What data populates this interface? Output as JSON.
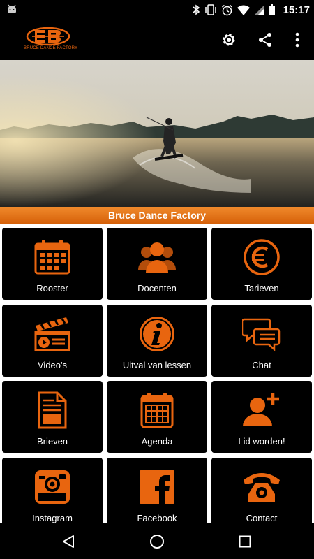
{
  "status_bar": {
    "time": "15:17",
    "icons": [
      "android-icon",
      "bluetooth-icon",
      "vibrate-icon",
      "alarm-icon",
      "wifi-icon",
      "signal-icon",
      "battery-icon"
    ]
  },
  "toolbar": {
    "logo_text": "BRUCE DANCE FACTORY",
    "actions": [
      "settings-icon",
      "share-icon",
      "overflow-menu-icon"
    ]
  },
  "banner": {
    "title": "Bruce Dance Factory"
  },
  "menu": [
    {
      "label": "Rooster",
      "icon": "calendar-grid-icon"
    },
    {
      "label": "Docenten",
      "icon": "people-icon"
    },
    {
      "label": "Tarieven",
      "icon": "euro-icon"
    },
    {
      "label": "Video's",
      "icon": "video-clapper-icon"
    },
    {
      "label": "Uitval van lessen",
      "icon": "info-icon"
    },
    {
      "label": "Chat",
      "icon": "chat-bubbles-icon"
    },
    {
      "label": "Brieven",
      "icon": "document-icon"
    },
    {
      "label": "Agenda",
      "icon": "agenda-icon"
    },
    {
      "label": "Lid worden!",
      "icon": "add-person-icon"
    },
    {
      "label": "Instagram",
      "icon": "instagram-icon"
    },
    {
      "label": "Facebook",
      "icon": "facebook-icon"
    },
    {
      "label": "Contact",
      "icon": "telephone-icon"
    }
  ],
  "navigation": [
    "back-icon",
    "home-icon",
    "recents-icon"
  ],
  "colors": {
    "accent": "#e8650f",
    "tile_bg": "#000000",
    "grid_bg": "#ffffff"
  }
}
